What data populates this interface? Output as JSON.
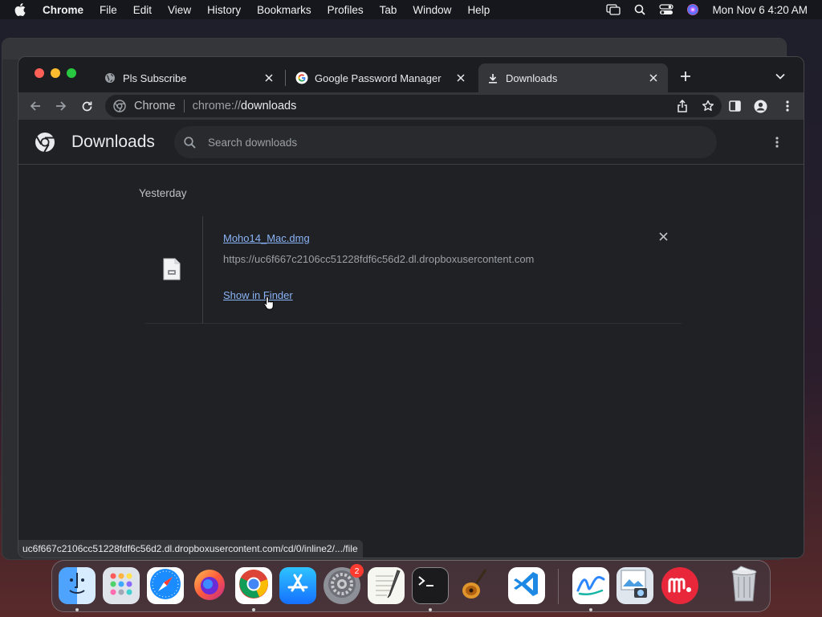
{
  "menubar": {
    "app_name": "Chrome",
    "items": [
      "File",
      "Edit",
      "View",
      "History",
      "Bookmarks",
      "Profiles",
      "Tab",
      "Window",
      "Help"
    ],
    "clock": "Mon Nov 6  4:20 AM"
  },
  "tabs": [
    {
      "title": "Pls Subscribe",
      "icon": "globe-icon",
      "active": false
    },
    {
      "title": "Google Password Manager",
      "icon": "google-icon",
      "active": false
    },
    {
      "title": "Downloads",
      "icon": "download-icon",
      "active": true
    }
  ],
  "omnibox": {
    "chip": "Chrome",
    "scheme": "chrome://",
    "host": "downloads"
  },
  "downloads_page": {
    "title": "Downloads",
    "search_placeholder": "Search downloads",
    "section_date": "Yesterday",
    "items": [
      {
        "file_name": "Moho14_Mac.dmg",
        "source_url": "https://uc6f667c2106cc51228fdf6c56d2.dl.dropboxusercontent.com",
        "action_label": "Show in Finder"
      }
    ]
  },
  "status_bar": {
    "link_preview": "uc6f667c2106cc51228fdf6c56d2.dl.dropboxusercontent.com/cd/0/inline2/.../file"
  },
  "dock": {
    "apps": [
      {
        "name": "Finder",
        "icon": "finder-icon",
        "running": true
      },
      {
        "name": "Launchpad",
        "icon": "launchpad-icon",
        "running": false
      },
      {
        "name": "Safari",
        "icon": "safari-icon",
        "running": false
      },
      {
        "name": "Firefox",
        "icon": "firefox-icon",
        "running": false
      },
      {
        "name": "Chrome",
        "icon": "chrome-icon",
        "running": true
      },
      {
        "name": "App Store",
        "icon": "app-store-icon",
        "running": false
      },
      {
        "name": "System Settings",
        "icon": "system-settings-icon",
        "running": false,
        "badge": "2"
      },
      {
        "name": "TextEdit",
        "icon": "textedit-icon",
        "running": false
      },
      {
        "name": "Terminal",
        "icon": "terminal-icon",
        "running": true
      },
      {
        "name": "GarageBand",
        "icon": "garageband-icon",
        "running": false
      },
      {
        "name": "Visual Studio Code",
        "icon": "vscode-icon",
        "running": false
      },
      {
        "name": "Freeform",
        "icon": "freeform-icon",
        "running": true
      },
      {
        "name": "Preview",
        "icon": "preview-icon",
        "running": false
      },
      {
        "name": "Mercury",
        "icon": "mercury-icon",
        "running": false
      },
      {
        "name": "Trash",
        "icon": "trash-icon",
        "running": false
      }
    ]
  },
  "colors": {
    "accent_link": "#8ab4f8",
    "page_bg": "#202124",
    "toolbar_bg": "#35363a"
  }
}
